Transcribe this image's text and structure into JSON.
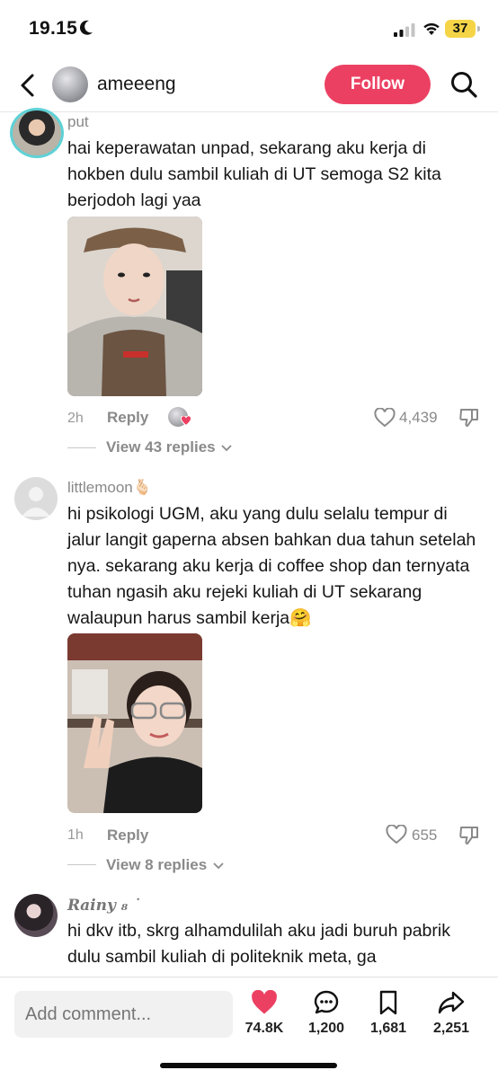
{
  "status_bar": {
    "time": "19.15",
    "battery": "37"
  },
  "header": {
    "username": "ameeeng",
    "follow_label": "Follow"
  },
  "comments": [
    {
      "username": "put",
      "text": "hai keperawatan unpad, sekarang aku kerja di hokben dulu sambil kuliah di UT semoga S2 kita berjodoh lagi yaa",
      "time": "2h",
      "reply_label": "Reply",
      "likes": "4,439",
      "view_replies": "View 43 replies"
    },
    {
      "username": "littlemoon",
      "username_emoji": "🫰🏻",
      "text": "hi psikologi UGM, aku yang dulu selalu tempur di jalur langit gaperna absen bahkan dua tahun setelah nya. sekarang aku kerja di coffee shop dan ternyata tuhan ngasih aku rejeki kuliah di UT sekarang walaupun harus sambil kerja🤗",
      "time": "1h",
      "reply_label": "Reply",
      "likes": "655",
      "view_replies": "View 8 replies"
    },
    {
      "username": "𝑹𝒂𝒊𝒏𝒚 ₈ ˙",
      "text": "hi dkv itb, skrg alhamdulilah aku jadi buruh pabrik dulu sambil kuliah di politeknik meta, ga"
    }
  ],
  "bottom_bar": {
    "placeholder": "Add comment...",
    "likes": "74.8K",
    "comments": "1,200",
    "saves": "1,681",
    "shares": "2,251",
    "like_color": "#ec4062"
  }
}
